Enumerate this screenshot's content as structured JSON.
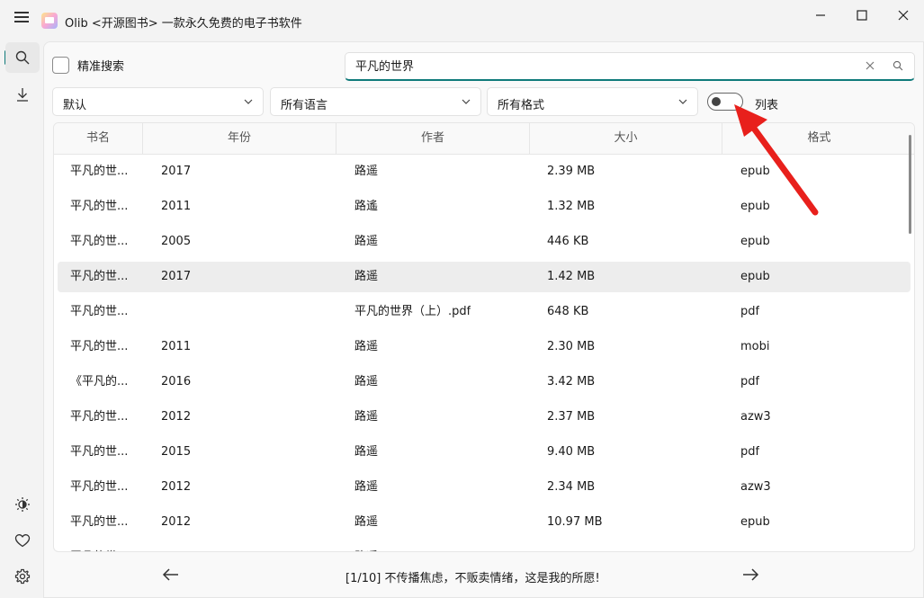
{
  "window": {
    "title": "Olib <开源图书> 一款永久免费的电子书软件",
    "controls": [
      "minimize",
      "maximize",
      "close"
    ]
  },
  "sidebar": {
    "top_items": [
      {
        "name": "search",
        "icon": "search-icon",
        "active": true
      },
      {
        "name": "downloads",
        "icon": "download-icon",
        "active": false
      }
    ],
    "bottom_items": [
      {
        "name": "theme",
        "icon": "brightness-icon"
      },
      {
        "name": "favorites",
        "icon": "heart-icon"
      },
      {
        "name": "settings",
        "icon": "gear-icon"
      }
    ]
  },
  "search": {
    "exact_label": "精准搜索",
    "exact_checked": false,
    "query": "平凡的世界"
  },
  "filters": {
    "sort": "默认",
    "language": "所有语言",
    "format": "所有格式",
    "list_toggle_label": "列表",
    "list_toggle_on": false
  },
  "table": {
    "columns": [
      "书名",
      "年份",
      "作者",
      "大小",
      "格式"
    ],
    "rows": [
      {
        "title": "平凡的世...",
        "year": "2017",
        "author": "路遥",
        "size": "2.39 MB",
        "format": "epub"
      },
      {
        "title": "平凡的世...",
        "year": "2011",
        "author": "路遙",
        "size": "1.32 MB",
        "format": "epub"
      },
      {
        "title": "平凡的世...",
        "year": "2005",
        "author": "路遥",
        "size": "446 KB",
        "format": "epub"
      },
      {
        "title": "平凡的世...",
        "year": "2017",
        "author": "路遥",
        "size": "1.42 MB",
        "format": "epub"
      },
      {
        "title": "平凡的世...",
        "year": "",
        "author": "平凡的世界（上）.pdf",
        "size": "648 KB",
        "format": "pdf"
      },
      {
        "title": "平凡的世...",
        "year": "2011",
        "author": "路遥",
        "size": "2.30 MB",
        "format": "mobi"
      },
      {
        "title": "《平凡的...",
        "year": "2016",
        "author": "路遥",
        "size": "3.42 MB",
        "format": "pdf"
      },
      {
        "title": "平凡的世...",
        "year": "2012",
        "author": "路遥",
        "size": "2.37 MB",
        "format": "azw3"
      },
      {
        "title": "平凡的世...",
        "year": "2015",
        "author": "路遥",
        "size": "9.40 MB",
        "format": "pdf"
      },
      {
        "title": "平凡的世...",
        "year": "2012",
        "author": "路遥",
        "size": "2.34 MB",
        "format": "azw3"
      },
      {
        "title": "平凡的世...",
        "year": "2012",
        "author": "路遥",
        "size": "10.97 MB",
        "format": "epub"
      },
      {
        "title": "平凡的世...",
        "year": "",
        "author": "路遥",
        "size": "",
        "format": ""
      }
    ],
    "selected_row": 3
  },
  "footer": {
    "text": "[1/10] 不传播焦虑，不贩卖情绪，这是我的所愿!"
  },
  "colors": {
    "accent": "#0f7a7a",
    "annotation_arrow": "#e8201c",
    "background": "#f3f3f3"
  }
}
